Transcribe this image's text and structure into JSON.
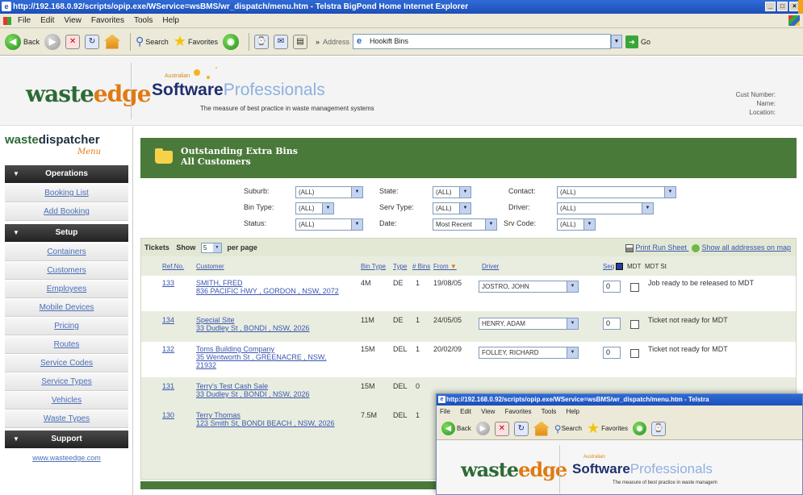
{
  "browser": {
    "title": "http://192.168.0.92/scripts/opip.exe/WService=wsBMS/wr_dispatch/menu.htm - Telstra BigPond Home Internet Explorer",
    "menu": [
      "File",
      "Edit",
      "View",
      "Favorites",
      "Tools",
      "Help"
    ],
    "toolbar": {
      "back": "Back",
      "search": "Search",
      "favorites": "Favorites",
      "address_label": "Address",
      "address_value": "Hookift Bins",
      "go": "Go"
    }
  },
  "header": {
    "logo": {
      "main": "waste",
      "accent": "edge"
    },
    "brand": {
      "small": "Australian",
      "bold": "Software",
      "light": "Professionals",
      "tagline": "The measure of best practice in waste management systems"
    },
    "customer": {
      "number_label": "Cust Number:",
      "name_label": "Name:",
      "location_label": "Location:"
    }
  },
  "sidebar": {
    "title_main": "waste",
    "title_accent": "dispatcher",
    "menu_label": "Menu",
    "sections": [
      {
        "label": "Operations",
        "items": [
          "Booking List",
          "Add Booking"
        ]
      },
      {
        "label": "Setup",
        "items": [
          "Containers",
          "Customers",
          "Employees",
          "Mobile Devices",
          "Pricing",
          "Routes",
          "Service Codes",
          "Service Types",
          "Vehicles",
          "Waste Types"
        ]
      },
      {
        "label": "Support",
        "items": []
      }
    ],
    "footer_link": "www.wasteedge.com"
  },
  "main": {
    "title_line1": "Outstanding Extra Bins",
    "title_line2": "All Customers",
    "filters": {
      "suburb": {
        "label": "Suburb:",
        "value": "(ALL)"
      },
      "state": {
        "label": "State:",
        "value": "(ALL)"
      },
      "contact": {
        "label": "Contact:",
        "value": "(ALL)"
      },
      "bin_type": {
        "label": "Bin Type:",
        "value": "(ALL)"
      },
      "serv_type": {
        "label": "Serv Type:",
        "value": "(ALL)"
      },
      "driver": {
        "label": "Driver:",
        "value": "(ALL)"
      },
      "status": {
        "label": "Status:",
        "value": "(ALL)"
      },
      "date": {
        "label": "Date:",
        "value": "Most Recent"
      },
      "srv_code": {
        "label": "Srv Code:",
        "value": "(ALL)"
      }
    },
    "tickets": {
      "label": "Tickets",
      "show_label": "Show",
      "show_value": "5",
      "per_page_label": "per page",
      "print_link": "Print Run Sheet",
      "map_link": "Show all addresses on map",
      "columns": {
        "ref": "Ref.No.",
        "customer": "Customer",
        "bin_type": "Bin Type",
        "type": "Type",
        "bins": "# Bins",
        "from": "From",
        "driver": "Driver",
        "seq": "Seq",
        "mdt": "MDT",
        "mdt_st": "MDT St"
      },
      "rows": [
        {
          "ref": "133",
          "customer": "SMITH, FRED",
          "address": "836 PACIFIC HWY , GORDON , NSW, 2072",
          "bin": "4M",
          "type": "DE",
          "bins": "1",
          "from": "19/08/05",
          "driver": "JOSTRO, JOHN",
          "seq": "0",
          "status": "Job ready to be released to MDT"
        },
        {
          "ref": "134",
          "customer": "Special Site",
          "address": "33 Dudley St , BONDI , NSW, 2026",
          "bin": "11M",
          "type": "DE",
          "bins": "1",
          "from": "24/05/05",
          "driver": "HENRY, ADAM",
          "seq": "0",
          "status": "Ticket not ready for MDT"
        },
        {
          "ref": "132",
          "customer": "Toms Building Company",
          "address": "35 Wentworth St , GREENACRE , NSW, 21932",
          "bin": "15M",
          "type": "DEL",
          "bins": "1",
          "from": "20/02/09",
          "driver": "FOLLEY, RICHARD",
          "seq": "0",
          "status": "Ticket not ready for MDT"
        },
        {
          "ref": "131",
          "customer": "Terry's Test Cash Sale",
          "address": "33 Dudley St , BONDI , NSW, 2026",
          "bin": "15M",
          "type": "DEL",
          "bins": "0",
          "from": "",
          "driver": "",
          "seq": "",
          "status": ""
        },
        {
          "ref": "130",
          "customer": "Terry Thomas",
          "address": "123 Smith St, BONDI BEACH , NSW, 2026",
          "bin": "7.5M",
          "type": "DEL",
          "bins": "1",
          "from": "",
          "driver": "",
          "seq": "",
          "status": ""
        }
      ]
    }
  },
  "overlay": {
    "title": "http://192.168.0.92/scripts/opip.exe/WService=wsBMS/wr_dispatch/menu.htm - Telstra",
    "menu": [
      "File",
      "Edit",
      "View",
      "Favorites",
      "Tools",
      "Help"
    ],
    "back": "Back",
    "search": "Search",
    "favorites": "Favorites",
    "brand_small": "Australian",
    "brand_bold": "Software",
    "brand_light": "Professionals",
    "tagline": "The measure of best practice in waste managem",
    "logo_main": "waste",
    "logo_accent": "edge"
  }
}
